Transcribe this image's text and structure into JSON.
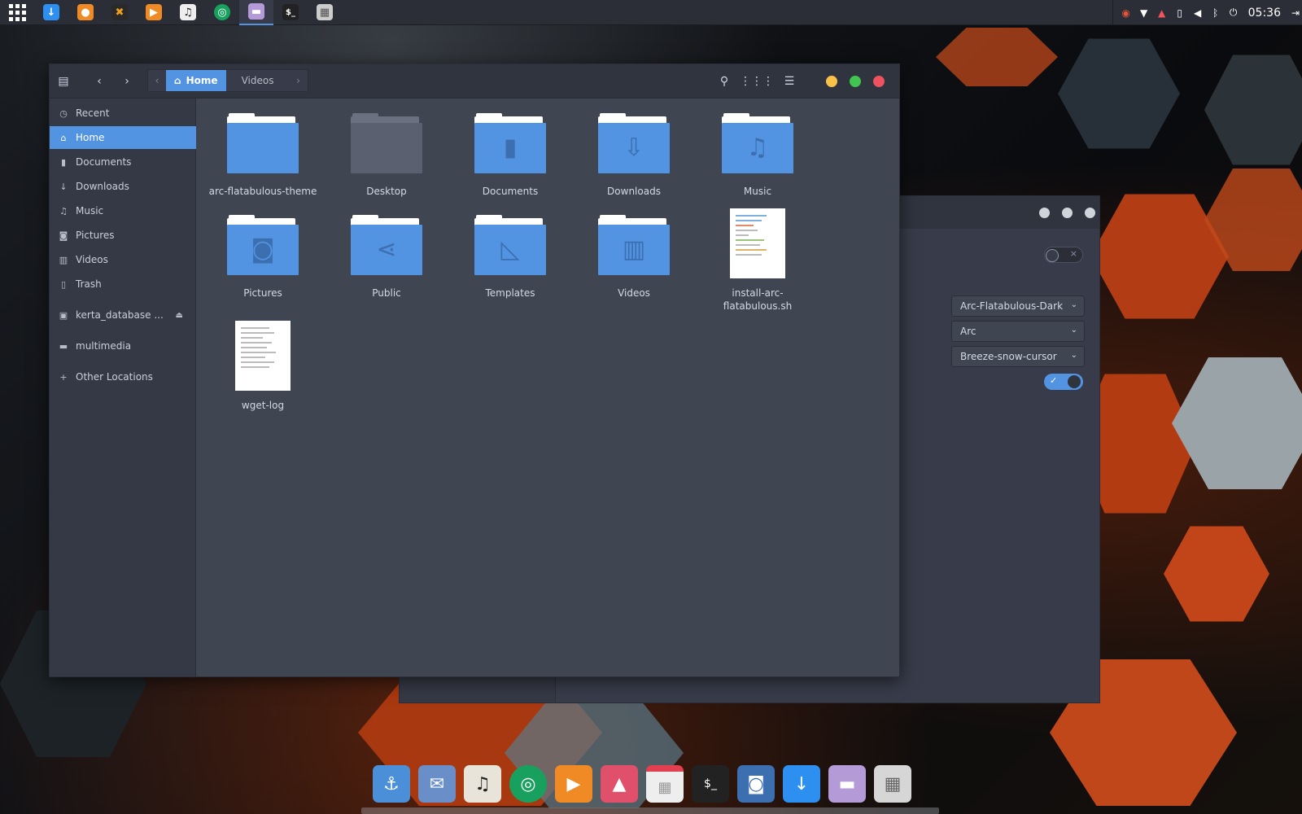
{
  "panel": {
    "clock": "05:36"
  },
  "file_manager": {
    "path": {
      "current": "Home",
      "next": "Videos"
    },
    "sidebar": [
      {
        "label": "Recent",
        "icon": "clock-icon"
      },
      {
        "label": "Home",
        "icon": "home-icon",
        "active": true
      },
      {
        "label": "Documents",
        "icon": "document-icon"
      },
      {
        "label": "Downloads",
        "icon": "download-icon"
      },
      {
        "label": "Music",
        "icon": "music-icon"
      },
      {
        "label": "Pictures",
        "icon": "camera-icon"
      },
      {
        "label": "Videos",
        "icon": "film-icon"
      },
      {
        "label": "Trash",
        "icon": "trash-icon"
      },
      {
        "label": "kerta_database ...",
        "icon": "drive-icon"
      },
      {
        "label": "multimedia",
        "icon": "folder-icon"
      },
      {
        "label": "Other Locations",
        "icon": "plus-icon"
      }
    ],
    "items": [
      {
        "label": "arc-flatabulous-theme",
        "kind": "folder"
      },
      {
        "label": "Desktop",
        "kind": "folder-dark"
      },
      {
        "label": "Documents",
        "kind": "folder",
        "emblem": "document"
      },
      {
        "label": "Downloads",
        "kind": "folder",
        "emblem": "download"
      },
      {
        "label": "Music",
        "kind": "folder",
        "emblem": "music"
      },
      {
        "label": "Pictures",
        "kind": "folder",
        "emblem": "camera"
      },
      {
        "label": "Public",
        "kind": "folder",
        "emblem": "share"
      },
      {
        "label": "Templates",
        "kind": "folder",
        "emblem": "triangle-ruler"
      },
      {
        "label": "Videos",
        "kind": "folder",
        "emblem": "film"
      },
      {
        "label": "install-arc-flatabulous.sh",
        "kind": "script"
      },
      {
        "label": "wget-log",
        "kind": "text"
      }
    ]
  },
  "tweak": {
    "gtk_theme": "Arc-Flatabulous-Dark",
    "icon_theme": "Arc",
    "cursor_theme": "Breeze-snow-cursor"
  },
  "colors": {
    "accent": "#5294e2",
    "minimize": "#f8c148",
    "maximize": "#41c451",
    "close": "#f0525f"
  }
}
